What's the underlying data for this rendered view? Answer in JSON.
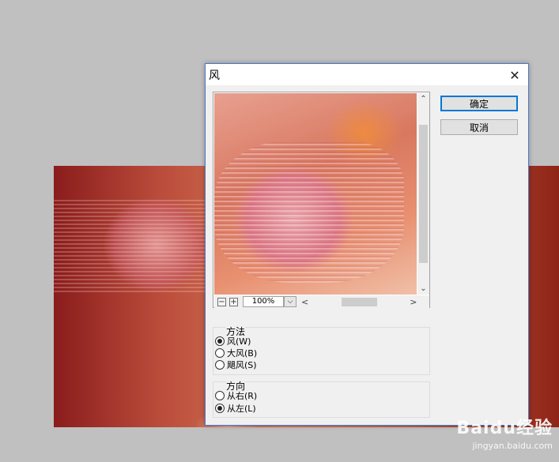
{
  "dialog": {
    "title": "风",
    "close_glyph": "✕",
    "ok_label": "确定",
    "cancel_label": "取消"
  },
  "preview": {
    "zoom_out_glyph": "−",
    "zoom_in_glyph": "+",
    "zoom_value": "100%",
    "dropdown_glyph": "⌵",
    "scroll_up_glyph": "⌃",
    "scroll_down_glyph": "⌄",
    "scroll_left_glyph": "<",
    "scroll_right_glyph": ">"
  },
  "method": {
    "title": "方法",
    "options": [
      {
        "label": "风(W)",
        "checked": true
      },
      {
        "label": "大风(B)",
        "checked": false
      },
      {
        "label": "飓风(S)",
        "checked": false
      }
    ]
  },
  "direction": {
    "title": "方向",
    "options": [
      {
        "label": "从右(R)",
        "checked": false
      },
      {
        "label": "从左(L)",
        "checked": true
      }
    ]
  },
  "watermark": {
    "logo": "Baidu经验",
    "url": "jingyan.baidu.com"
  },
  "colors": {
    "accent": "#0078d7",
    "dialog_bg": "#f0f0f0",
    "desktop_bg": "#c0c0c0"
  }
}
